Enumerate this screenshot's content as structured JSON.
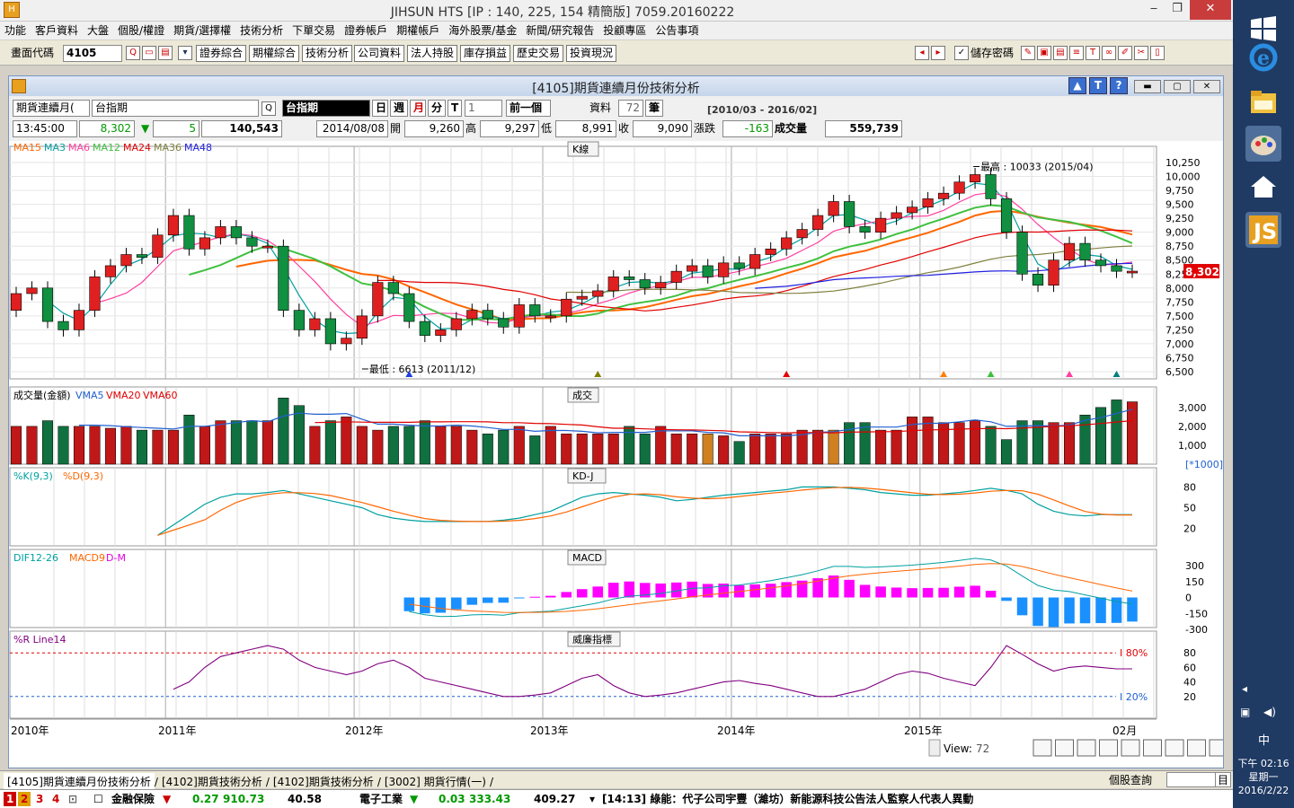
{
  "window": {
    "title": "JIHSUN HTS    [IP : 140, 225, 154 精簡版] 7059.20160222",
    "logo": "jihsun-logo"
  },
  "menu": [
    "功能",
    "客戶資料",
    "大盤",
    "個股/權證",
    "期貨/選擇權",
    "技術分析",
    "下單交易",
    "證券帳戶",
    "期權帳戶",
    "海外股票/基金",
    "新聞/研究報告",
    "投顧專區",
    "公告事項"
  ],
  "toolbar": {
    "code_label": "畫面代碼",
    "code_value": "4105",
    "buttons": [
      "證券綜合",
      "期權綜合",
      "技術分析",
      "公司資料",
      "法人持股",
      "庫存損益",
      "歷史交易",
      "投資現況"
    ],
    "save_pwd": "儲存密碼"
  },
  "inner": {
    "title": "[4105]期貨連續月份技術分析"
  },
  "controls": {
    "product": "期貨連續月(",
    "symbol": "台指期",
    "name": "台指期",
    "day": "日",
    "week": "週",
    "month": "月",
    "minute": "分",
    "tick": "T",
    "period": "1",
    "prev": "前一個",
    "data_label": "資料",
    "count": "72",
    "unit": "筆",
    "range": "[2010/03 - 2016/02]"
  },
  "quote": {
    "time": "13:45:00",
    "price": "8,302",
    "change": "5",
    "volume_top": "140,543",
    "date": "2014/08/08",
    "open_label": "開",
    "open": "9,260",
    "high_label": "高",
    "high": "9,297",
    "low_label": "低",
    "low": "8,991",
    "close_label": "收",
    "close": "9,090",
    "chg_label": "漲跌",
    "chg": "-163",
    "vol_label": "成交量",
    "vol": "559,739"
  },
  "panels": {
    "kline": {
      "title": "K線",
      "legend": [
        {
          "t": "MA15",
          "c": "#ff6600"
        },
        {
          "t": "MA3",
          "c": "#00a0a0"
        },
        {
          "t": "MA6",
          "c": "#ff40a0"
        },
        {
          "t": "MA12",
          "c": "#40c040"
        },
        {
          "t": "MA24",
          "c": "#e00000"
        },
        {
          "t": "MA36",
          "c": "#808040"
        },
        {
          "t": "MA48",
          "c": "#2020e0"
        }
      ],
      "high_note": "最高 : 10033 (2015/04)",
      "low_note": "最低 : 6613 (2011/12)",
      "last": "8,302",
      "yticks": [
        "10,250",
        "10,000",
        "9,750",
        "9,500",
        "9,250",
        "9,000",
        "8,750",
        "8,500",
        "8,250",
        "8,000",
        "7,750",
        "7,500",
        "7,250",
        "7,000",
        "6,750",
        "6,500"
      ]
    },
    "volume": {
      "title": "成交",
      "legend": [
        {
          "t": "成交量(金額)",
          "c": "#000"
        },
        {
          "t": "VMA5",
          "c": "#2060d0"
        },
        {
          "t": "VMA20",
          "c": "#e00000"
        },
        {
          "t": "VMA60",
          "c": "#e00000"
        }
      ],
      "yticks": [
        "3,000",
        "2,000",
        "1,000"
      ],
      "scale": "[*1000]"
    },
    "kd": {
      "title": "KD-J",
      "legend": [
        {
          "t": "%K(9,3)",
          "c": "#00a0a0"
        },
        {
          "t": "%D(9,3)",
          "c": "#ff6600"
        }
      ],
      "yticks": [
        "80",
        "50",
        "20"
      ]
    },
    "macd": {
      "title": "MACD",
      "legend": [
        {
          "t": "DIF12-26",
          "c": "#00a0a0"
        },
        {
          "t": "MACD9",
          "c": "#ff6600"
        },
        {
          "t": "D-M",
          "c": "#e000e0"
        }
      ],
      "yticks": [
        "300",
        "150",
        "0",
        "-150",
        "-300"
      ]
    },
    "wr": {
      "title": "威廉指標",
      "legend": [
        {
          "t": "%R Line14",
          "c": "#800080"
        }
      ],
      "yticks": [
        "80",
        "60",
        "40",
        "20"
      ],
      "h80": "I 80%",
      "h20": "I 20%"
    }
  },
  "xaxis": [
    "2010年",
    "2011年",
    "2012年",
    "2013年",
    "2014年",
    "2015年",
    "02月"
  ],
  "view": {
    "label": "View:",
    "value": "72"
  },
  "tabs": [
    "[4105]期貨連續月份技術分析",
    "[4102]期貨技術分析",
    "[4102]期貨技術分析",
    "[3002] 期貨行情(一)"
  ],
  "tab_right": "個股查詢",
  "tab_btn": "目",
  "ticker": {
    "nums": [
      "1",
      "2",
      "3",
      "4"
    ],
    "a_name": "金融保險",
    "a_chg": "0.27",
    "a_val": "910.73",
    "a_amt": "40.58",
    "b_name": "電子工業",
    "b_chg": "0.03",
    "b_val": "333.43",
    "b_amt": "409.27",
    "news": "[14:13] 綠能：代子公司宇豐（濰坊）新能源科技公告法人監察人代表人異動"
  },
  "clock": {
    "time": "下午 02:16",
    "weekday": "星期一",
    "date": "2016/2/22",
    "ime": "中"
  },
  "chart_data": {
    "type": "candlestick",
    "title": "K線",
    "months": [
      "2010/03",
      "2010/04",
      "2010/05",
      "2010/06",
      "2010/07",
      "2010/08",
      "2010/09",
      "2010/10",
      "2010/11",
      "2010/12",
      "2011/01",
      "2011/02",
      "2011/03",
      "2011/04",
      "2011/05",
      "2011/06",
      "2011/07",
      "2011/08",
      "2011/09",
      "2011/10",
      "2011/11",
      "2011/12",
      "2012/01",
      "2012/02",
      "2012/03",
      "2012/04",
      "2012/05",
      "2012/06",
      "2012/07",
      "2012/08",
      "2012/09",
      "2012/10",
      "2012/11",
      "2012/12",
      "2013/01",
      "2013/02",
      "2013/03",
      "2013/04",
      "2013/05",
      "2013/06",
      "2013/07",
      "2013/08",
      "2013/09",
      "2013/10",
      "2013/11",
      "2013/12",
      "2014/01",
      "2014/02",
      "2014/03",
      "2014/04",
      "2014/05",
      "2014/06",
      "2014/07",
      "2014/08",
      "2014/09",
      "2014/10",
      "2014/11",
      "2014/12",
      "2015/01",
      "2015/02",
      "2015/03",
      "2015/04",
      "2015/05",
      "2015/06",
      "2015/07",
      "2015/08",
      "2015/09",
      "2015/10",
      "2015/11",
      "2015/12",
      "2016/01",
      "2016/02"
    ],
    "close": [
      7900,
      8000,
      7400,
      7250,
      7600,
      8200,
      8400,
      8600,
      8550,
      8950,
      9300,
      8700,
      8900,
      9100,
      8900,
      8750,
      8750,
      7600,
      7250,
      7450,
      7000,
      7100,
      7500,
      8100,
      7900,
      7400,
      7150,
      7250,
      7450,
      7600,
      7450,
      7300,
      7700,
      7500,
      7500,
      7800,
      7850,
      7950,
      8200,
      8150,
      8000,
      8100,
      8300,
      8400,
      8200,
      8450,
      8350,
      8600,
      8700,
      8900,
      9050,
      9300,
      9550,
      9100,
      9000,
      9250,
      9350,
      9450,
      9600,
      9700,
      9900,
      10033,
      9600,
      9000,
      8250,
      8050,
      8500,
      8800,
      8500,
      8400,
      8300,
      8302
    ],
    "ohlc_note": "open/high/low approximated from candle drawing",
    "volume": [
      2.0,
      2.0,
      2.3,
      2.0,
      2.0,
      2.0,
      1.9,
      2.0,
      1.8,
      1.8,
      1.8,
      2.6,
      2.0,
      2.3,
      2.3,
      2.3,
      2.3,
      3.5,
      3.1,
      2.0,
      2.3,
      2.5,
      2.0,
      1.8,
      2.0,
      2.0,
      2.3,
      2.0,
      2.0,
      1.8,
      1.6,
      1.8,
      2.0,
      1.5,
      2.0,
      1.6,
      1.6,
      1.6,
      1.6,
      2.0,
      1.6,
      2.0,
      1.6,
      1.6,
      1.6,
      1.5,
      1.2,
      1.6,
      1.6,
      1.6,
      1.8,
      1.8,
      1.8,
      2.2,
      2.2,
      1.8,
      1.8,
      2.5,
      2.5,
      2.2,
      2.2,
      2.3,
      2.0,
      1.3,
      2.3,
      2.3,
      2.2,
      2.2,
      2.6,
      3.0,
      3.4,
      3.3,
      2.9,
      3.0,
      3.0,
      3.4,
      1.0
    ],
    "k": [
      0,
      0,
      0,
      0,
      0,
      0,
      0,
      0,
      0,
      10,
      25,
      40,
      55,
      65,
      70,
      70,
      72,
      75,
      70,
      65,
      60,
      55,
      50,
      40,
      35,
      32,
      30,
      30,
      30,
      30,
      30,
      32,
      35,
      40,
      45,
      55,
      65,
      70,
      72,
      70,
      68,
      65,
      60,
      62,
      65,
      68,
      70,
      72,
      74,
      76,
      80,
      80,
      80,
      78,
      76,
      72,
      70,
      68,
      68,
      70,
      72,
      75,
      78,
      75,
      70,
      55,
      45,
      40,
      38,
      40,
      40,
      40,
      42
    ],
    "wr": [
      null,
      null,
      null,
      null,
      null,
      null,
      null,
      null,
      null,
      null,
      30,
      40,
      60,
      75,
      80,
      85,
      90,
      85,
      70,
      60,
      55,
      50,
      55,
      65,
      70,
      60,
      45,
      40,
      35,
      30,
      25,
      20,
      20,
      22,
      25,
      35,
      45,
      50,
      35,
      25,
      20,
      22,
      25,
      30,
      35,
      40,
      42,
      38,
      35,
      30,
      25,
      20,
      20,
      25,
      30,
      40,
      50,
      55,
      52,
      45,
      40,
      35,
      60,
      90,
      78,
      65,
      55,
      60,
      62,
      60,
      58,
      58
    ]
  }
}
